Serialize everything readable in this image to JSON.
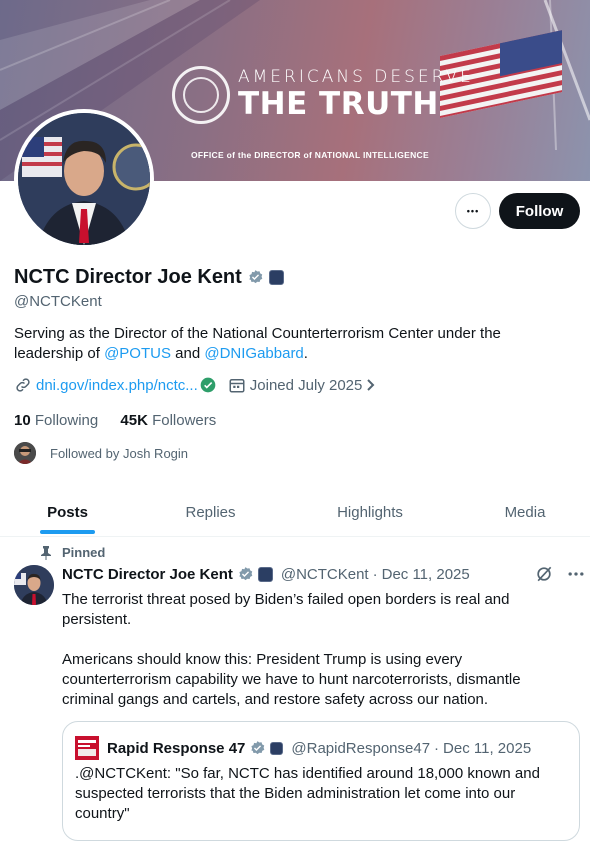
{
  "banner": {
    "line1": "AMERICANS DESERVE",
    "line2": "THE TRUTH",
    "office": "OFFICE of the DIRECTOR of NATIONAL INTELLIGENCE"
  },
  "profile": {
    "name": "NCTC Director Joe Kent",
    "handle": "@NCTCKent",
    "bio_before": "Serving as the Director of the National Counterterrorism Center under the leadership of ",
    "bio_mention1": "@POTUS",
    "bio_and": " and ",
    "bio_mention2": "@DNIGabbard",
    "bio_end": ".",
    "website": "dni.gov/index.php/nctc...",
    "joined": "Joined July 2025",
    "following_count": "10",
    "following_label": " Following",
    "followers_count": "45K",
    "followers_label": " Followers",
    "followed_by": "Followed by Josh Rogin",
    "follow_label": "Follow",
    "more_label": "•••"
  },
  "tabs": [
    {
      "label": "Posts"
    },
    {
      "label": "Replies"
    },
    {
      "label": "Highlights"
    },
    {
      "label": "Media"
    }
  ],
  "post": {
    "pinned_label": "Pinned",
    "name": "NCTC Director Joe Kent",
    "handle": "@NCTCKent",
    "separator": "·",
    "date": "Dec 11, 2025",
    "para1": "The terrorist threat posed by Biden’s failed open borders is real and persistent.",
    "para2": "Americans should know this: President Trump is using every counterterrorism capability we have to hunt narcoterrorists, dismantle criminal gangs and cartels, and restore safety across our nation.",
    "quote": {
      "name": "Rapid Response 47",
      "handle": "@RapidResponse47",
      "separator": "·",
      "date": "Dec 11, 2025",
      "text": ".@NCTCKent: \"So far, NCTC has identified around 18,000 known and suspected terrorists that the Biden administration let come into our country\""
    }
  },
  "colors": {
    "accent": "#1d9bf0",
    "text": "#0f1419",
    "muted": "#536471",
    "verified": "#829aab",
    "follow_bg": "#0f1419"
  }
}
